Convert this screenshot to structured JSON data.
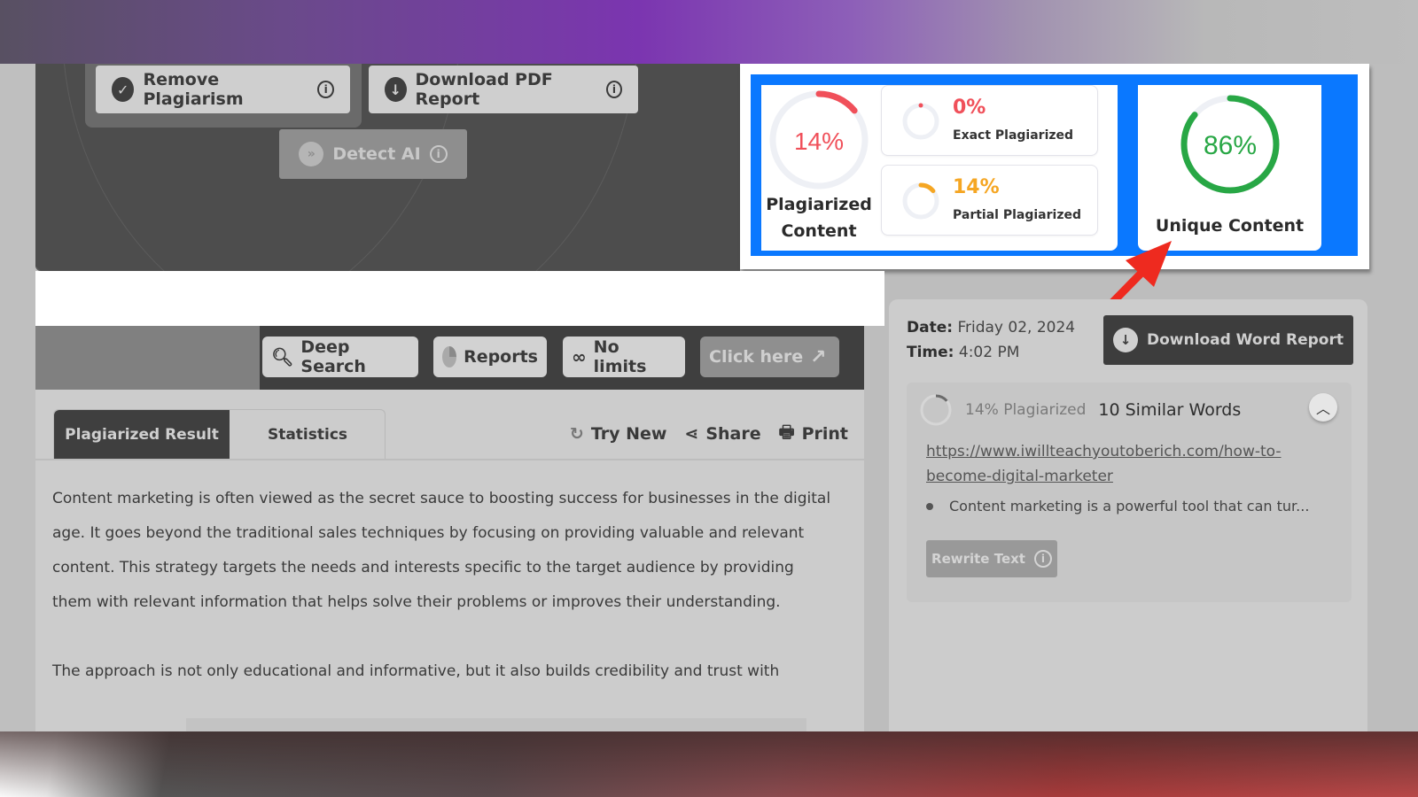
{
  "hero": {
    "remove_plagiarism_label": "Remove Plagiarism",
    "download_pdf_label": "Download PDF Report",
    "detect_ai_label": "Detect AI"
  },
  "stats": {
    "plagiarized": {
      "value_label": "14%",
      "value": 14,
      "label_line1": "Plagiarized",
      "label_line2": "Content",
      "color": "#f0505a"
    },
    "exact": {
      "value_label": "0%",
      "value": 0,
      "label": "Exact Plagiarized",
      "color": "#f0505a"
    },
    "partial": {
      "value_label": "14%",
      "value": 14,
      "label": "Partial Plagiarized",
      "color": "#f5a623"
    },
    "unique": {
      "value_label": "86%",
      "value": 86,
      "label": "Unique Content",
      "color": "#28a745"
    },
    "frame_color": "#0a78ff",
    "annotation_color": "#ee2a1f"
  },
  "toolbar": {
    "deep_search_label": "Deep Search",
    "reports_label": "Reports",
    "no_limits_label": "No limits",
    "click_here_label": "Click here"
  },
  "tabs": [
    {
      "label": "Plagiarized Result",
      "active": true
    },
    {
      "label": "Statistics",
      "active": false
    }
  ],
  "actions": {
    "try_new_label": "Try New",
    "share_label": "Share",
    "print_label": "Print"
  },
  "content": {
    "paragraphs": [
      "Content marketing is often viewed as the secret sauce to boosting success for businesses in the digital age. It goes beyond the traditional sales techniques by focusing on providing valuable and relevant content. This strategy targets the needs and interests specific to the target audience by providing them with relevant information that helps solve their problems or improves their understanding.",
      "The approach is not only educational and informative, but it also builds credibility and trust with"
    ]
  },
  "report": {
    "date_label": "Date:",
    "date_value": "Friday 02, 2024",
    "time_label": "Time:",
    "time_value": "4:02 PM",
    "download_word_label": "Download Word Report",
    "match": {
      "percent_label": "14% Plagiarized",
      "percent": 14,
      "similar_words_label": "10 Similar Words",
      "url": "https://www.iwillteachyoutoberich.com/how-to-become-digital-marketer",
      "snippet": "Content marketing is a powerful tool that can tur...",
      "rewrite_label": "Rewrite Text"
    }
  }
}
